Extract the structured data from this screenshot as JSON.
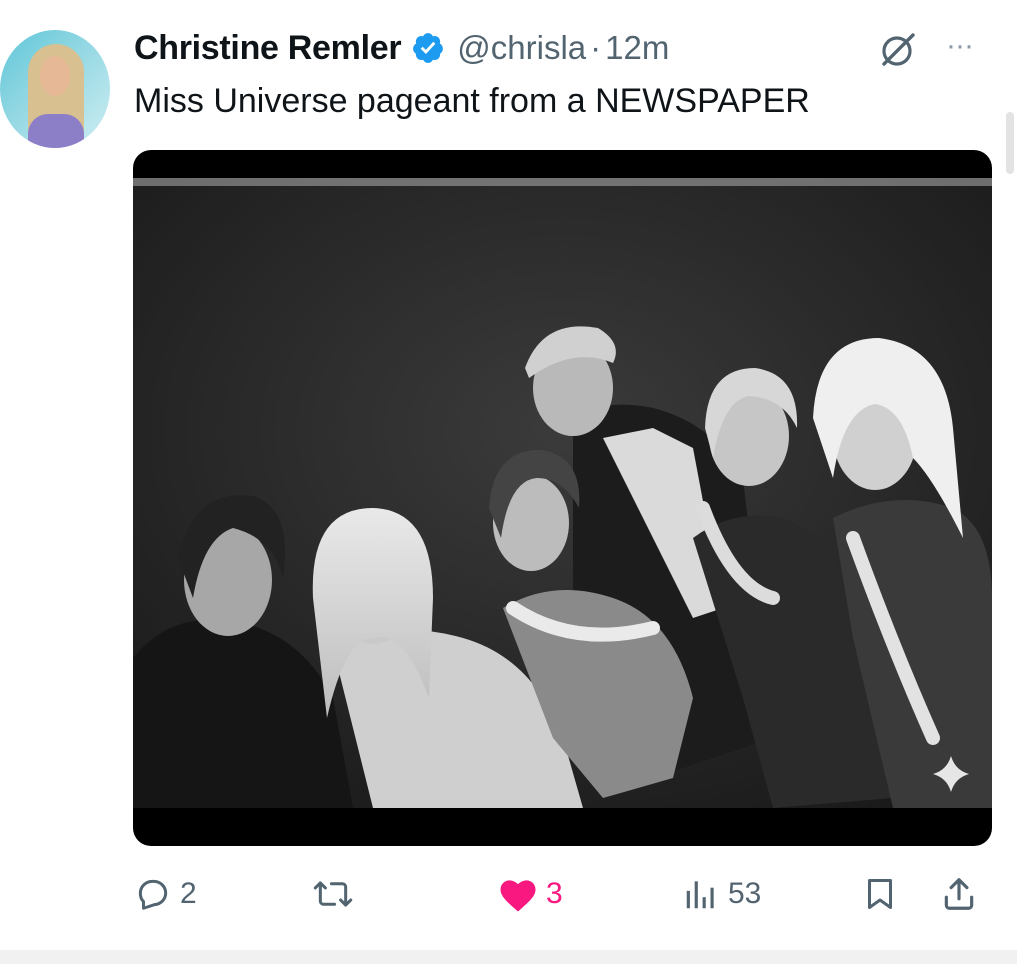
{
  "tweet": {
    "author_name": "Christine Remler",
    "handle": "@chrisla",
    "separator": "·",
    "time": "12m",
    "text": "Miss Universe pageant from a NEWSPAPER",
    "verified_icon": "verified-badge-icon",
    "grok_icon": "grok-icon",
    "more_icon": "more-options-icon",
    "more_glyph": "···"
  },
  "media": {
    "kind": "black-and-white group photograph",
    "overlay_icon": "sparkle-icon"
  },
  "actions": {
    "replies": "2",
    "retweets": "",
    "likes": "3",
    "views": "53",
    "icons": [
      "reply-icon",
      "retweet-icon",
      "like-icon",
      "views-icon",
      "bookmark-icon",
      "share-icon"
    ]
  },
  "colors": {
    "verified": "#1d9bf0",
    "like": "#f91880",
    "secondary_text": "#536471"
  }
}
